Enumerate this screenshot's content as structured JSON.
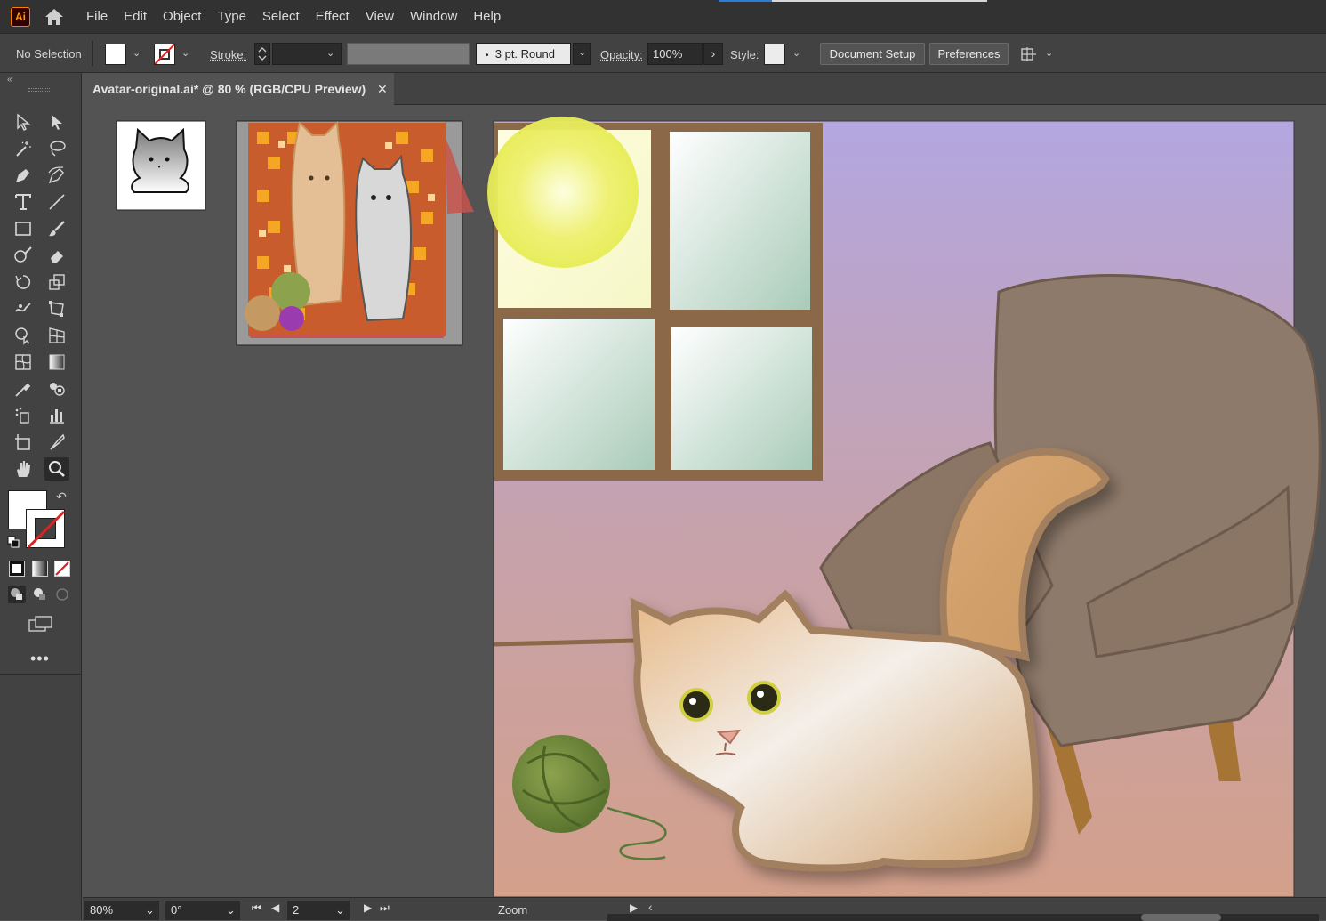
{
  "app": {
    "logo_text": "Ai"
  },
  "menu": [
    "File",
    "Edit",
    "Object",
    "Type",
    "Select",
    "Effect",
    "View",
    "Window",
    "Help"
  ],
  "control": {
    "selection_label": "No Selection",
    "stroke_label": "Stroke:",
    "brush_value": "3 pt. Round",
    "opacity_label": "Opacity:",
    "opacity_value": "100%",
    "style_label": "Style:",
    "document_setup": "Document Setup",
    "preferences": "Preferences"
  },
  "document": {
    "tab_title": "Avatar-original.ai* @ 80 % (RGB/CPU Preview)",
    "close_glyph": "✕"
  },
  "status": {
    "zoom_value": "80%",
    "rotate_value": "0°",
    "artboard_value": "2",
    "tool_name": "Zoom"
  },
  "colors": {
    "chrome_dark": "#323232",
    "panel": "#424242",
    "canvas": "#535353",
    "accent_blue": "#2c7cd8",
    "wall_top": "#b3a6e0",
    "floor": "#d2a08c",
    "frame_brown": "#8c6a4a",
    "cat_orange": "#d9a874",
    "yarn_green": "#6e8a3a",
    "chair": "#8e7a6a"
  },
  "icons": {
    "toolbar": [
      "selection-icon",
      "direct-selection-icon",
      "magic-wand-icon",
      "lasso-icon",
      "pen-icon",
      "curvature-icon",
      "type-icon",
      "line-icon",
      "rectangle-icon",
      "paintbrush-icon",
      "shaper-icon",
      "eraser-icon",
      "rotate-icon",
      "scale-icon",
      "warp-icon",
      "free-transform-icon",
      "shape-builder-icon",
      "perspective-grid-icon",
      "mesh-icon",
      "gradient-icon",
      "eyedropper-icon",
      "blend-icon",
      "symbol-sprayer-icon",
      "column-graph-icon",
      "artboard-icon",
      "slice-icon",
      "hand-icon",
      "zoom-icon"
    ]
  }
}
